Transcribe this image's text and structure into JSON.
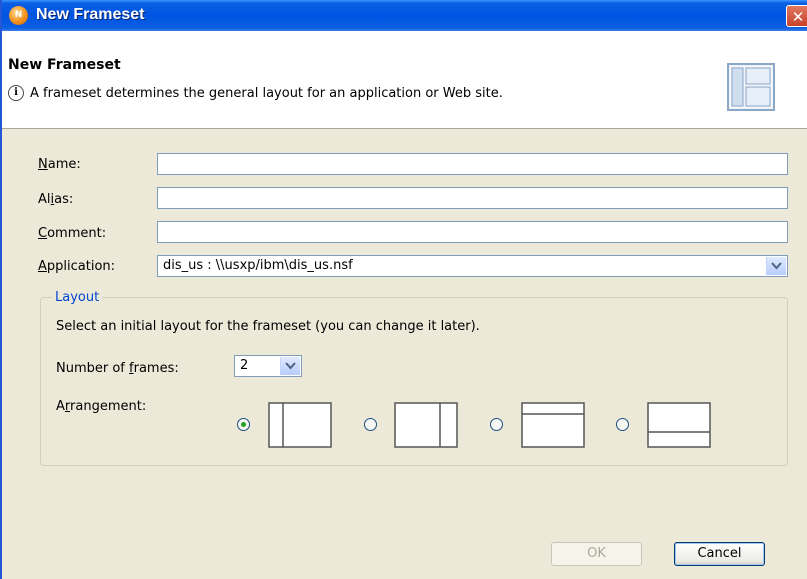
{
  "window": {
    "title": "New Frameset",
    "close_label": "✕",
    "app_icon_label": "N"
  },
  "banner": {
    "title": "New Frameset",
    "description": "A frameset determines the general layout for an application or Web site.",
    "info_icon": "i",
    "graphic_icon": "frameset-graphic-icon"
  },
  "form": {
    "name": {
      "label_underlined": "N",
      "label_rest": "ame:",
      "value": ""
    },
    "alias": {
      "label_pre": "Al",
      "label_underlined": "i",
      "label_rest": "as:",
      "value": ""
    },
    "comment": {
      "label_underlined": "C",
      "label_rest": "omment:",
      "value": ""
    },
    "application": {
      "label_underlined": "A",
      "label_rest": "pplication:",
      "value": "dis_us : \\\\usxp/ibm\\dis_us.nsf"
    }
  },
  "layout": {
    "group_label": "Layout",
    "instructions": "Select an initial layout for the frameset (you can change it later).",
    "frames_label_pre": "Number of ",
    "frames_label_underlined": "f",
    "frames_label_rest": "rames:",
    "frames_value": "2",
    "arrangement_label_pre": "A",
    "arrangement_label_underlined": "r",
    "arrangement_label_rest": "rangement:",
    "arrangement_options": [
      "left-frame-icon",
      "right-frame-icon",
      "top-frame-icon",
      "bottom-frame-icon"
    ],
    "selected_arrangement": 0
  },
  "buttons": {
    "ok": "OK",
    "cancel": "Cancel"
  },
  "colors": {
    "title_bar": "#0054e3",
    "group_label": "#0046d5",
    "selected_radio": "#21a121"
  }
}
